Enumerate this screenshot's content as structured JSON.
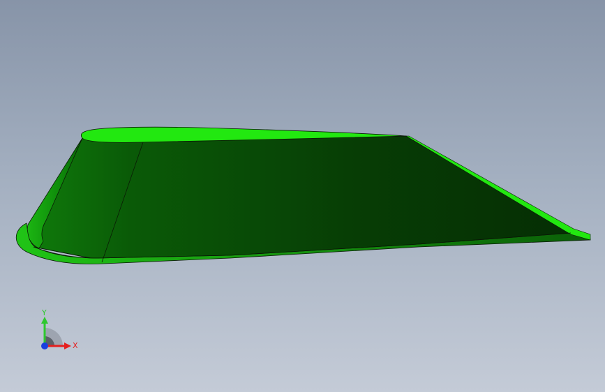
{
  "viewport": {
    "model": "swept-airfoil-wing",
    "colors": {
      "background_top": "#8794a8",
      "background_bottom": "#c4cbd7",
      "top_face": "#22e810",
      "side_face": "#0b4a08",
      "side_face_dark": "#052f04",
      "edge": "#0a1a06"
    }
  },
  "triad": {
    "y_label": "Y",
    "x_label": "X",
    "y_color": "#2ec82e",
    "x_color": "#e51f1f",
    "z_color": "#1a3fe0"
  }
}
